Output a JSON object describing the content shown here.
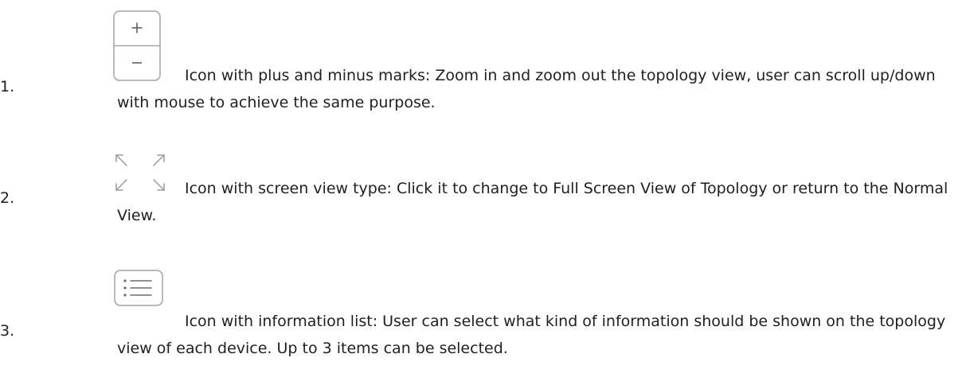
{
  "items": [
    {
      "number": "1.",
      "icon": "zoom-in-out-icon",
      "text": "Icon with plus and minus marks: Zoom in and zoom out the topology view, user can scroll up/down with mouse to achieve the same purpose."
    },
    {
      "number": "2.",
      "icon": "fullscreen-toggle-icon",
      "text": "Icon with screen view type: Click it to change to Full Screen View of Topology or return to the Normal View."
    },
    {
      "number": "3.",
      "icon": "info-list-icon",
      "text": "Icon with information list: User can select what kind of information should be shown on the topology view of each device. Up to 3 items can be selected."
    }
  ],
  "colors": {
    "text": "#1f1f1f",
    "icon_stroke": "#9a9a9a",
    "icon_glyph": "#6b6b6b"
  }
}
